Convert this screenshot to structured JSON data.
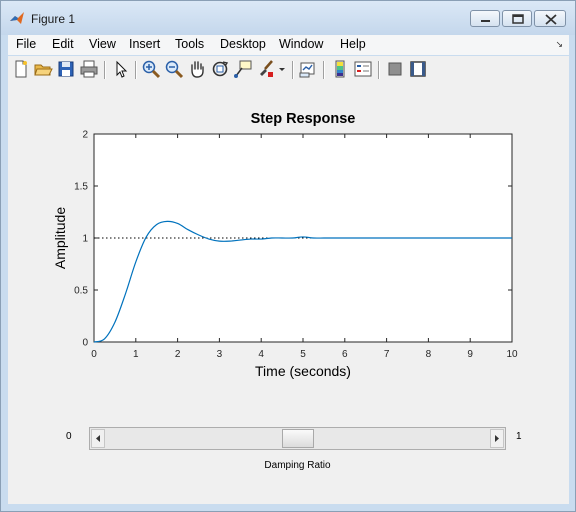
{
  "window": {
    "title": "Figure 1"
  },
  "menu": {
    "items": [
      "File",
      "Edit",
      "View",
      "Insert",
      "Tools",
      "Desktop",
      "Window",
      "Help"
    ],
    "corner_icon": "dock-arrow-icon"
  },
  "toolbar": {
    "buttons": [
      "new-figure-icon",
      "open-file-icon",
      "save-icon",
      "print-icon",
      "select-arrow-icon",
      "zoom-in-icon",
      "zoom-out-icon",
      "pan-hand-icon",
      "rotate-3d-icon",
      "data-cursor-icon",
      "brush-icon",
      "brush-dropdown-icon",
      "link-plot-icon",
      "colorbar-icon",
      "legend-icon",
      "hide-plot-tools-icon",
      "show-plot-tools-icon"
    ]
  },
  "slider": {
    "min_label": "0",
    "max_label": "1",
    "value": 0.5,
    "label": "Damping Ratio"
  },
  "chart_data": {
    "type": "line",
    "title": "Step Response",
    "xlabel": "Time (seconds)",
    "ylabel": "Amplitude",
    "xlim": [
      0,
      10
    ],
    "ylim": [
      0,
      2
    ],
    "xticks": [
      "0",
      "1",
      "2",
      "3",
      "4",
      "5",
      "6",
      "7",
      "8",
      "9",
      "10"
    ],
    "yticks": [
      "0",
      "0.5",
      "1",
      "1.5",
      "2"
    ],
    "reference_line": {
      "y": 1,
      "style": "dotted"
    },
    "series": [
      {
        "color": "#0072bd",
        "x": [
          0,
          0.25,
          0.5,
          0.75,
          1.0,
          1.25,
          1.5,
          1.75,
          2.0,
          2.25,
          2.5,
          2.75,
          3.0,
          3.25,
          3.5,
          3.75,
          4.0,
          4.25,
          4.5,
          4.75,
          5.0,
          5.25,
          5.5,
          5.75,
          6.0,
          6.5,
          7.0,
          7.5,
          8.0,
          8.5,
          9.0,
          9.5,
          10.0
        ],
        "y": [
          0,
          0.03,
          0.19,
          0.46,
          0.77,
          1.01,
          1.13,
          1.16,
          1.14,
          1.08,
          1.03,
          0.99,
          0.97,
          0.97,
          0.98,
          0.99,
          0.99,
          1.0,
          1.0,
          1.0,
          1.01,
          1.0,
          1.0,
          1.0,
          1.0,
          1.0,
          1.0,
          1.0,
          1.0,
          1.0,
          1.0,
          1.0,
          1.0
        ]
      }
    ]
  }
}
